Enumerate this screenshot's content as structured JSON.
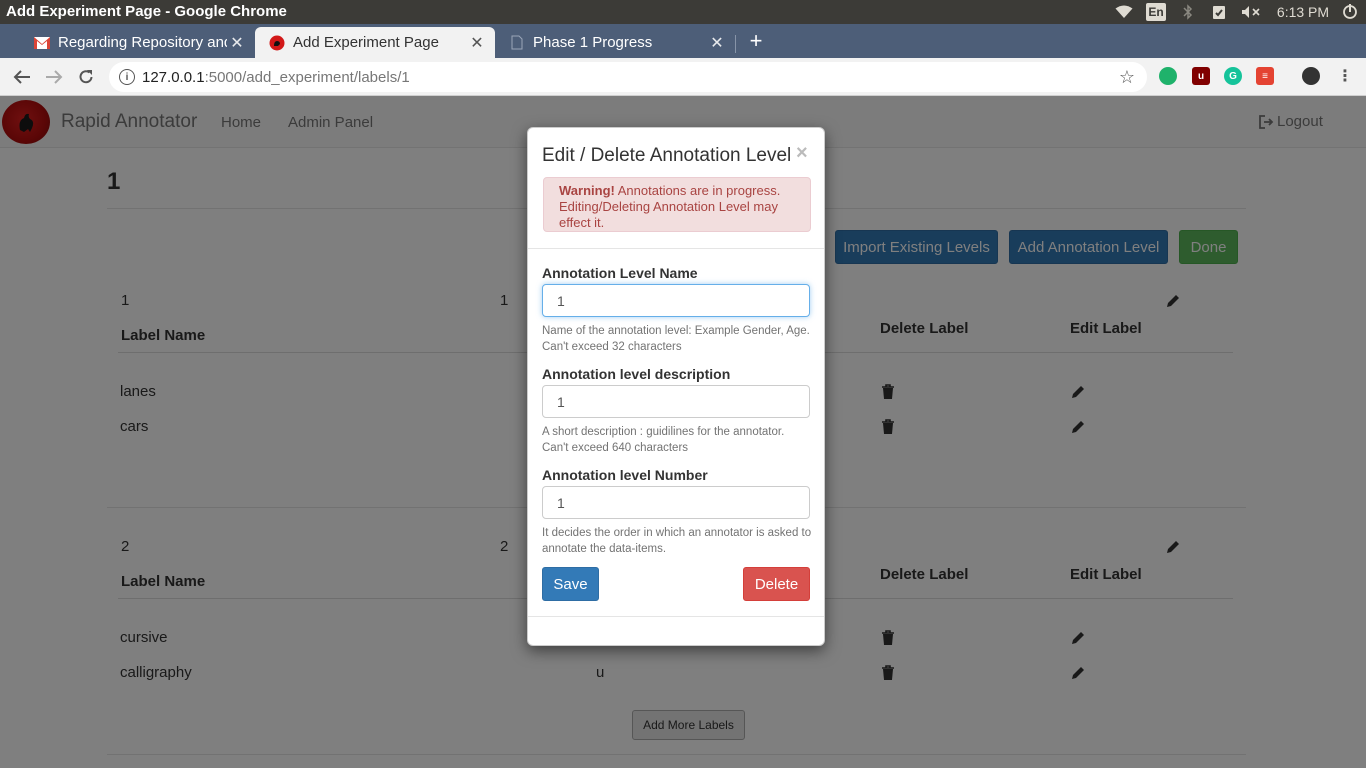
{
  "window": {
    "title": "Add Experiment Page - Google Chrome"
  },
  "tray": {
    "lang": "En",
    "time": "6:13 PM"
  },
  "tabs": [
    {
      "title": "Regarding Repository and",
      "icon": "gmail-icon",
      "active": false
    },
    {
      "title": "Add Experiment Page",
      "icon": "rooster-favicon",
      "active": true
    },
    {
      "title": "Phase 1 Progress",
      "icon": "document-icon",
      "active": false
    }
  ],
  "address": {
    "host": "127.0.0.1",
    "rest": ":5000/add_experiment/labels/1"
  },
  "app": {
    "brand": "Rapid Annotator",
    "nav": {
      "home": "Home",
      "admin": "Admin Panel",
      "logout": "Logout"
    },
    "experiment_title": "1",
    "buttons": {
      "import": "Import Existing Levels",
      "add_level": "Add Annotation Level",
      "done": "Done",
      "add_more": "Add More Labels"
    },
    "levels": [
      {
        "number": "1",
        "number2": "1",
        "headers": {
          "label_name": "Label Name",
          "delete": "Delete Label",
          "edit": "Edit Label"
        },
        "rows": [
          {
            "name": "lanes",
            "key": ""
          },
          {
            "name": "cars",
            "key": ""
          }
        ]
      },
      {
        "number": "2",
        "number2": "2",
        "headers": {
          "label_name": "Label Name",
          "delete": "Delete Label",
          "edit": "Edit Label"
        },
        "rows": [
          {
            "name": "cursive",
            "key": ""
          },
          {
            "name": "calligraphy",
            "key": "u"
          }
        ]
      }
    ]
  },
  "modal": {
    "title": "Edit / Delete Annotation Level",
    "close": "×",
    "warning_strong": "Warning!",
    "warning_text": "Annotations are in progress. Editing/Deleting Annotation Level may effect it.",
    "fields": {
      "name": {
        "label": "Annotation Level Name",
        "value": "1",
        "help": "Name of the annotation level: Example Gender, Age. Can't exceed 32 characters"
      },
      "description": {
        "label": "Annotation level description",
        "value": "1",
        "help": "A short description : guidilines for the annotator. Can't exceed 640 characters"
      },
      "number": {
        "label": "Annotation level Number",
        "value": "1",
        "help": "It decides the order in which an annotator is asked to annotate the data-items."
      }
    },
    "save": "Save",
    "delete": "Delete"
  },
  "colors": {
    "primary": "#337ab7",
    "success": "#5cb85c",
    "danger": "#d9534f",
    "warning_bg": "#f2dede",
    "warning_text": "#a94442"
  }
}
